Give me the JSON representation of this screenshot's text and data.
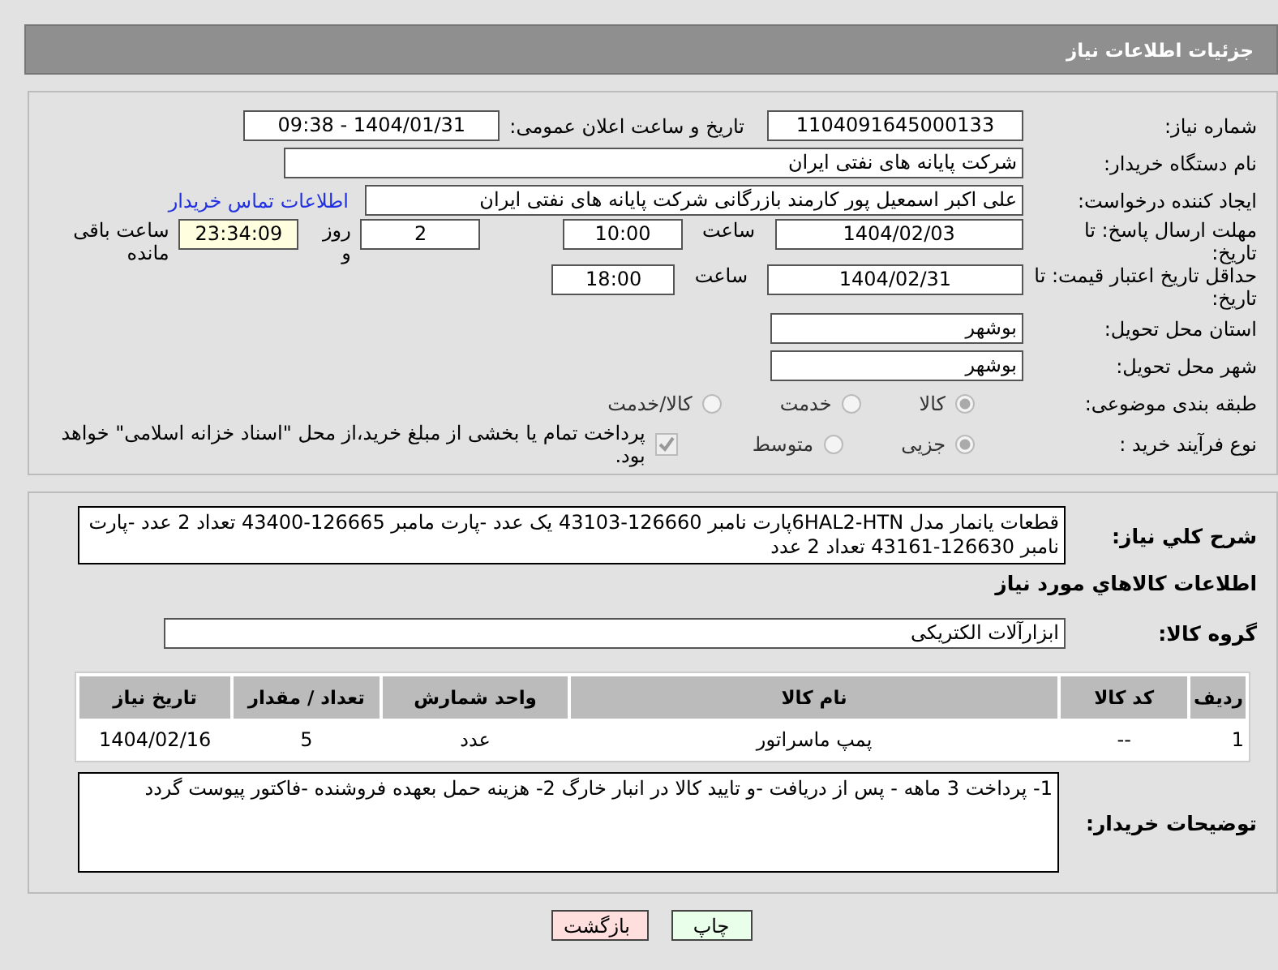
{
  "header": {
    "title": "جزئیات اطلاعات نیاز"
  },
  "need_number": {
    "label": "شماره نیاز:",
    "value": "1104091645000133"
  },
  "announce_date": {
    "label": "تاریخ و ساعت اعلان عمومی:",
    "value": "1404/01/31 - 09:38"
  },
  "buyer_org": {
    "label": "نام دستگاه خریدار:",
    "value": "شرکت پایانه های نفتی ایران"
  },
  "requester": {
    "label": "ایجاد کننده درخواست:",
    "value": "علی اکبر اسمعیل پور کارمند بازرگانی شرکت پایانه های نفتی ایران",
    "link": "اطلاعات تماس خریدار"
  },
  "reply_deadline": {
    "label": "مهلت ارسال پاسخ: تا تاریخ:",
    "date": "1404/02/03",
    "time_label": "ساعت",
    "time": "10:00",
    "days": "2",
    "days_label": "روز و",
    "remaining": "23:34:09",
    "remaining_label": "ساعت باقی مانده"
  },
  "price_validity": {
    "label": "حداقل تاریخ اعتبار قیمت: تا تاریخ:",
    "date": "1404/02/31",
    "time_label": "ساعت",
    "time": "18:00"
  },
  "province": {
    "label": "استان محل تحویل:",
    "value": "بوشهر"
  },
  "city": {
    "label": "شهر محل تحویل:",
    "value": "بوشهر"
  },
  "category": {
    "label": "طبقه بندی موضوعی:",
    "options": [
      {
        "label": "کالا",
        "selected": true
      },
      {
        "label": "خدمت",
        "selected": false
      },
      {
        "label": "کالا/خدمت",
        "selected": false
      }
    ]
  },
  "purchase_type": {
    "label": "نوع فرآیند خرید :",
    "options": [
      {
        "label": "جزیی",
        "selected": true
      },
      {
        "label": "متوسط",
        "selected": false
      }
    ],
    "payment_note": {
      "text": "پرداخت تمام یا بخشی از مبلغ خرید،از محل \"اسناد خزانه اسلامی\" خواهد بود.",
      "checked": true
    }
  },
  "description": {
    "label": "شرح کلي نياز:",
    "value": "قطعات یانمار مدل 6HAL2-HTNپارت نامبر 126660-43103 یک عدد -پارت مامبر 126665-43400 تعداد 2 عدد -پارت نامبر 126630-43161 تعداد 2 عدد"
  },
  "goods_heading": "اطلاعات كالاهاي مورد نياز",
  "goods_group": {
    "label": "گروه کالا:",
    "value": "ابزارآلات الکتریکی"
  },
  "table": {
    "columns": [
      "ردیف",
      "کد کالا",
      "نام کالا",
      "واحد شمارش",
      "تعداد / مقدار",
      "تاریخ نیاز"
    ],
    "rows": [
      [
        "1",
        "--",
        "پمپ ماسراتور",
        "عدد",
        "5",
        "1404/02/16"
      ]
    ]
  },
  "buyer_notes": {
    "label": "توضیحات خریدار:",
    "value": "1- پرداخت 3 ماهه - پس از دریافت -و تایید کالا در انبار خارگ 2- هزینه حمل بعهده فروشنده -فاکتور پیوست گردد"
  },
  "buttons": [
    {
      "label": "چاپ",
      "kind": "print"
    },
    {
      "label": "بازگشت",
      "kind": "back"
    }
  ]
}
